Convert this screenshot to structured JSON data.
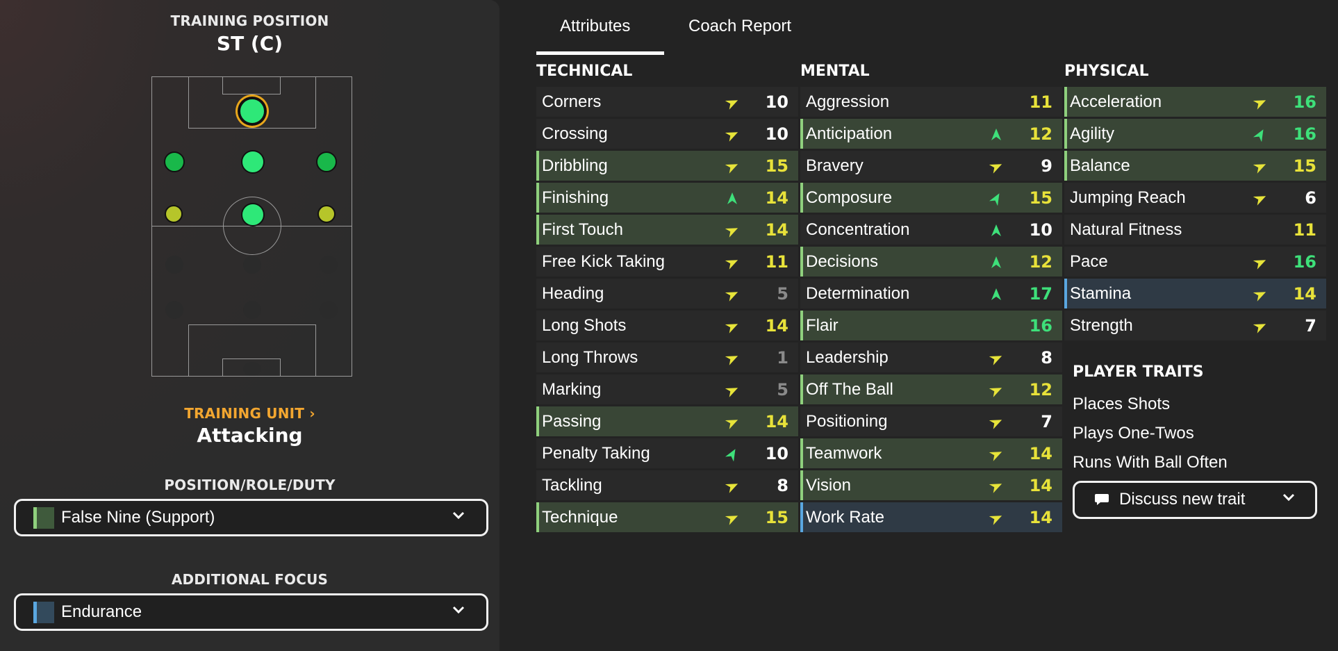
{
  "left_panel": {
    "training_position_label": "TRAINING POSITION",
    "training_position_value": "ST (C)",
    "training_unit_label": "TRAINING UNIT",
    "training_unit_chevron": "›",
    "training_unit_value": "Attacking",
    "prd_label": "POSITION/ROLE/DUTY",
    "prd_value": "False Nine (Support)",
    "prd_swatch": "#3f5a3c",
    "additional_focus_label": "ADDITIONAL FOCUS",
    "additional_focus_value": "Endurance",
    "additional_focus_swatch": "#334a5c",
    "chevron": "⌄"
  },
  "tabs": [
    {
      "label": "Attributes",
      "active": true
    },
    {
      "label": "Coach Report",
      "active": false
    }
  ],
  "sections": {
    "technical": {
      "title": "TECHNICAL",
      "rows": [
        {
          "name": "Corners",
          "value": "10",
          "hl": "",
          "arrow": "right"
        },
        {
          "name": "Crossing",
          "value": "10",
          "hl": "",
          "arrow": "right"
        },
        {
          "name": "Dribbling",
          "value": "15",
          "hl": "green",
          "arrow": "right"
        },
        {
          "name": "Finishing",
          "value": "14",
          "hl": "green",
          "arrow": "up"
        },
        {
          "name": "First Touch",
          "value": "14",
          "hl": "green",
          "arrow": "right"
        },
        {
          "name": "Free Kick Taking",
          "value": "11",
          "hl": "",
          "arrow": "right"
        },
        {
          "name": "Heading",
          "value": "5",
          "hl": "",
          "arrow": "right"
        },
        {
          "name": "Long Shots",
          "value": "14",
          "hl": "",
          "arrow": "right"
        },
        {
          "name": "Long Throws",
          "value": "1",
          "hl": "",
          "arrow": "right"
        },
        {
          "name": "Marking",
          "value": "5",
          "hl": "",
          "arrow": "right"
        },
        {
          "name": "Passing",
          "value": "14",
          "hl": "green",
          "arrow": "right"
        },
        {
          "name": "Penalty Taking",
          "value": "10",
          "hl": "",
          "arrow": "upright"
        },
        {
          "name": "Tackling",
          "value": "8",
          "hl": "",
          "arrow": "right"
        },
        {
          "name": "Technique",
          "value": "15",
          "hl": "green",
          "arrow": "right"
        }
      ]
    },
    "mental": {
      "title": "MENTAL",
      "rows": [
        {
          "name": "Aggression",
          "value": "11",
          "hl": "",
          "arrow": ""
        },
        {
          "name": "Anticipation",
          "value": "12",
          "hl": "green",
          "arrow": "up"
        },
        {
          "name": "Bravery",
          "value": "9",
          "hl": "",
          "arrow": "right"
        },
        {
          "name": "Composure",
          "value": "15",
          "hl": "green",
          "arrow": "upright"
        },
        {
          "name": "Concentration",
          "value": "10",
          "hl": "",
          "arrow": "up"
        },
        {
          "name": "Decisions",
          "value": "12",
          "hl": "green",
          "arrow": "up"
        },
        {
          "name": "Determination",
          "value": "17",
          "hl": "",
          "arrow": "up"
        },
        {
          "name": "Flair",
          "value": "16",
          "hl": "green",
          "arrow": ""
        },
        {
          "name": "Leadership",
          "value": "8",
          "hl": "",
          "arrow": "right"
        },
        {
          "name": "Off The Ball",
          "value": "12",
          "hl": "green",
          "arrow": "right"
        },
        {
          "name": "Positioning",
          "value": "7",
          "hl": "",
          "arrow": "right"
        },
        {
          "name": "Teamwork",
          "value": "14",
          "hl": "green",
          "arrow": "right"
        },
        {
          "name": "Vision",
          "value": "14",
          "hl": "green",
          "arrow": "right"
        },
        {
          "name": "Work Rate",
          "value": "14",
          "hl": "blue",
          "arrow": "right"
        }
      ]
    },
    "physical": {
      "title": "PHYSICAL",
      "rows": [
        {
          "name": "Acceleration",
          "value": "16",
          "hl": "green",
          "arrow": "right"
        },
        {
          "name": "Agility",
          "value": "16",
          "hl": "green",
          "arrow": "upright"
        },
        {
          "name": "Balance",
          "value": "15",
          "hl": "green",
          "arrow": "right"
        },
        {
          "name": "Jumping Reach",
          "value": "6",
          "hl": "",
          "arrow": "right"
        },
        {
          "name": "Natural Fitness",
          "value": "11",
          "hl": "",
          "arrow": ""
        },
        {
          "name": "Pace",
          "value": "16",
          "hl": "",
          "arrow": "right"
        },
        {
          "name": "Stamina",
          "value": "14",
          "hl": "blue",
          "arrow": "right"
        },
        {
          "name": "Strength",
          "value": "7",
          "hl": "",
          "arrow": "right"
        }
      ]
    }
  },
  "player_traits": {
    "title": "PLAYER TRAITS",
    "items": [
      "Places Shots",
      "Plays One-Twos",
      "Runs With Ball Often"
    ],
    "discuss_label": "Discuss new trait",
    "discuss_icon": "speech-bubble-icon"
  },
  "colors": {
    "value_white": "#ffffff",
    "value_yellow": "#e8e23a",
    "value_green": "#3ee07a",
    "value_grey": "#8a8a8a",
    "arrow_yellow": "#e7e43a",
    "arrow_green": "#3ee07a",
    "row_green_bg": "#394636",
    "row_green_bar": "#8fd07d",
    "row_blue_bg": "#2f3a45",
    "row_blue_bar": "#5aa7e0",
    "row_plain_bg": "#292929",
    "accent_orange": "#f2a630"
  }
}
